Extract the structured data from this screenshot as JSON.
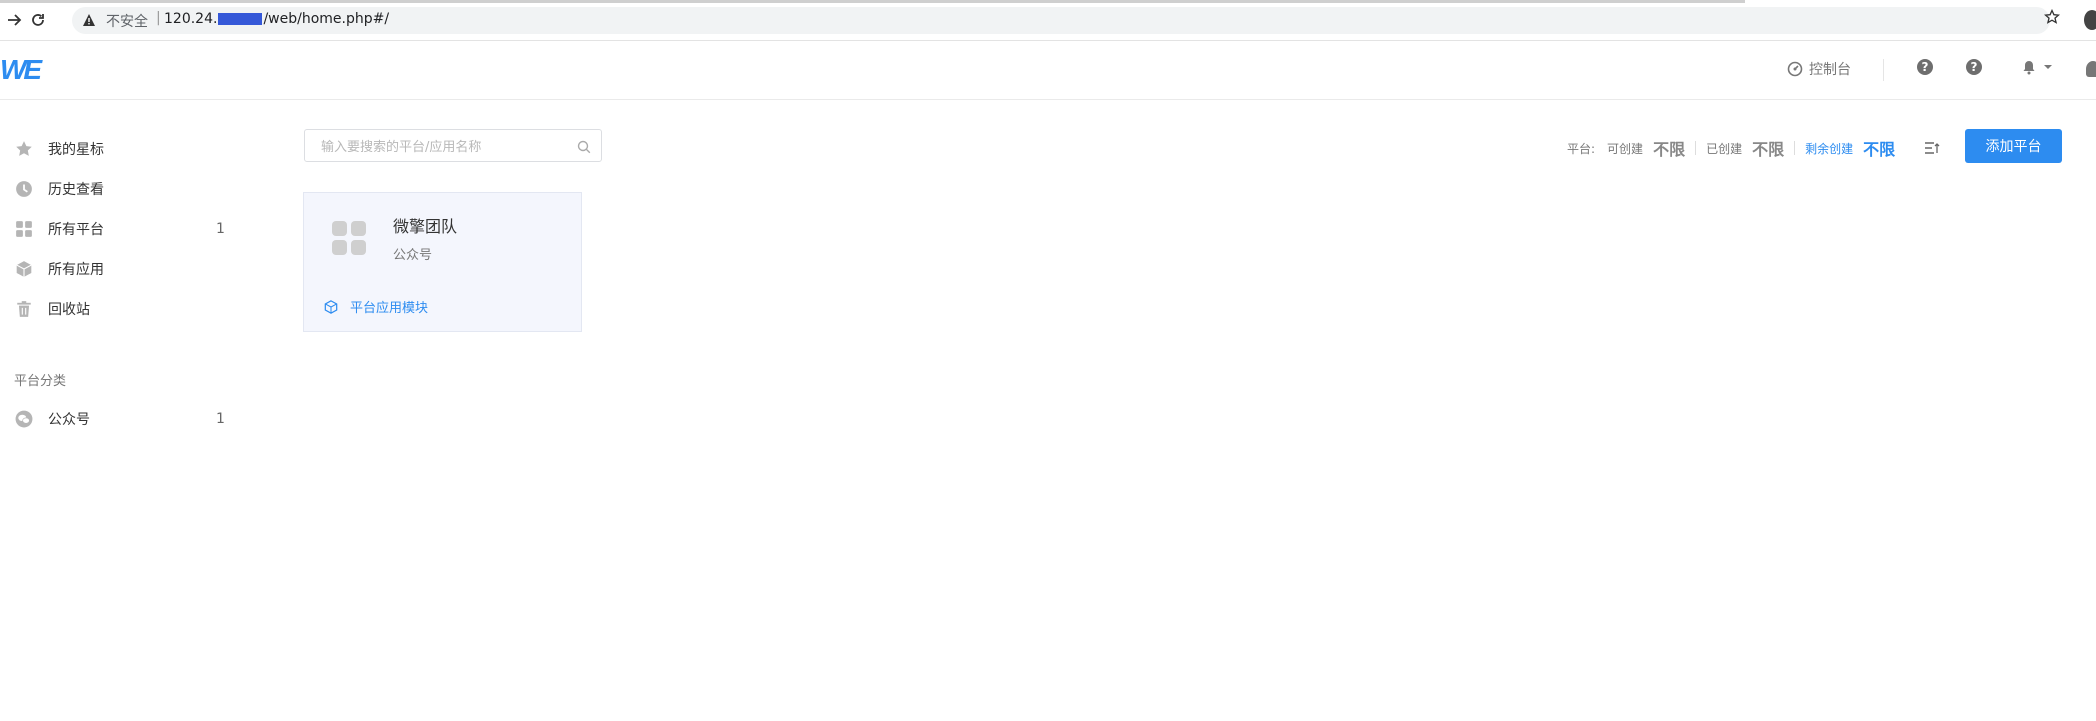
{
  "browser": {
    "security_label": "不安全",
    "url_prefix": "120.24.",
    "url_suffix": "/web/home.php#/"
  },
  "header": {
    "logo_text": "WE",
    "console_label": "控制台"
  },
  "sidebar": {
    "items": [
      {
        "label": "我的星标",
        "icon": "star-icon",
        "count": ""
      },
      {
        "label": "历史查看",
        "icon": "clock-icon",
        "count": ""
      },
      {
        "label": "所有平台",
        "icon": "grid-icon",
        "count": "1"
      },
      {
        "label": "所有应用",
        "icon": "cube-icon",
        "count": ""
      },
      {
        "label": "回收站",
        "icon": "trash-icon",
        "count": ""
      }
    ],
    "category_title": "平台分类",
    "categories": [
      {
        "label": "公众号",
        "icon": "wechat-icon",
        "count": "1"
      }
    ]
  },
  "search": {
    "placeholder": "输入要搜索的平台/应用名称"
  },
  "stats": {
    "platform_label": "平台:",
    "can_create_label": "可创建",
    "can_create_value": "不限",
    "created_label": "已创建",
    "created_value": "不限",
    "remaining_label": "剩余创建",
    "remaining_value": "不限"
  },
  "toolbar": {
    "add_platform_label": "添加平台"
  },
  "cards": [
    {
      "name": "微擎团队",
      "type": "公众号",
      "link_label": "平台应用模块"
    }
  ],
  "colors": {
    "accent": "#2d8cf0",
    "card_bg": "#f4f6fd"
  }
}
